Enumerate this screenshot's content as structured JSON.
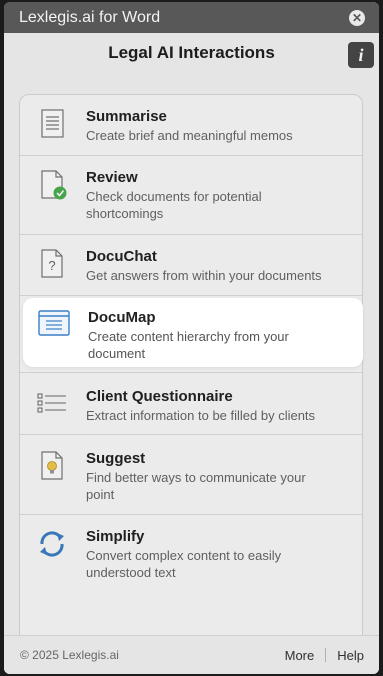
{
  "window": {
    "title": "Lexlegis.ai for Word"
  },
  "header": {
    "title": "Legal AI Interactions",
    "info_label": "i"
  },
  "items": [
    {
      "name": "Summarise",
      "desc": "Create brief and meaningful memos"
    },
    {
      "name": "Review",
      "desc": "Check documents for potential shortcomings"
    },
    {
      "name": "DocuChat",
      "desc": "Get answers from within your documents"
    },
    {
      "name": "DocuMap",
      "desc": "Create content hierarchy from your document"
    },
    {
      "name": "Client Questionnaire",
      "desc": "Extract information to be filled by clients"
    },
    {
      "name": "Suggest",
      "desc": "Find better ways to communicate your point"
    },
    {
      "name": "Simplify",
      "desc": "Convert complex content to easily understood text"
    }
  ],
  "footer": {
    "copyright": "© 2025 Lexlegis.ai",
    "more": "More",
    "help": "Help"
  },
  "colors": {
    "accent": "#3d7fc4",
    "check": "#4caf50",
    "bulb": "#f2c94c"
  }
}
